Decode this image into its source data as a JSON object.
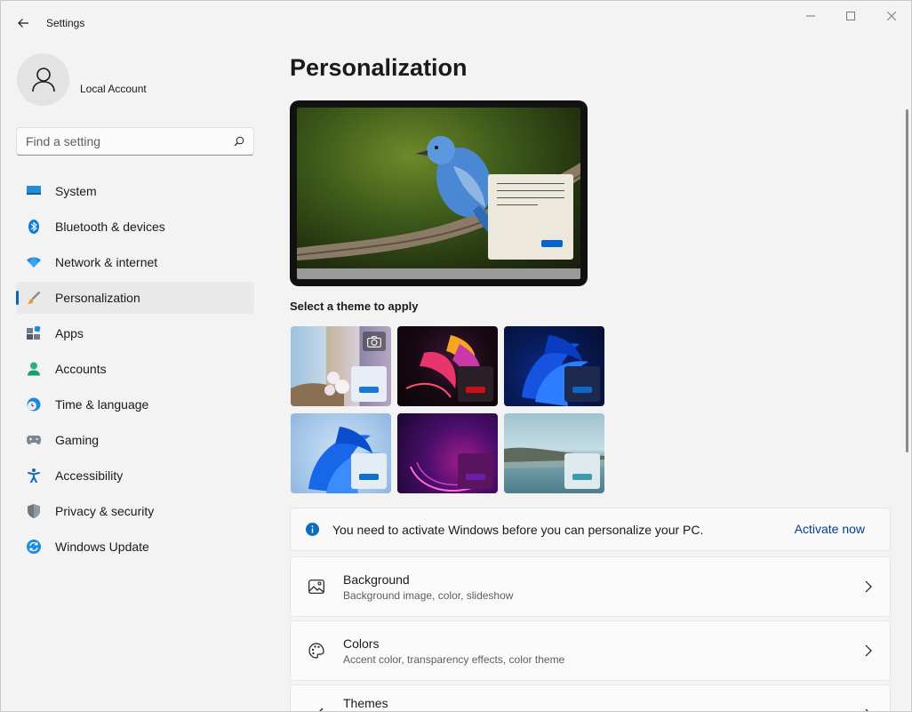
{
  "window": {
    "title": "Settings",
    "controls": {
      "minimize_icon": "minimize-icon",
      "maximize_icon": "maximize-icon",
      "close_icon": "close-icon"
    }
  },
  "account": {
    "name": "Local Account",
    "avatar_icon": "user-icon"
  },
  "search": {
    "placeholder": "Find a setting",
    "value": "",
    "icon": "search-icon"
  },
  "sidebar": {
    "items": [
      {
        "label": "System",
        "icon": "system-icon",
        "active": false
      },
      {
        "label": "Bluetooth & devices",
        "icon": "bluetooth-icon",
        "active": false
      },
      {
        "label": "Network & internet",
        "icon": "wifi-icon",
        "active": false
      },
      {
        "label": "Personalization",
        "icon": "brush-icon",
        "active": true
      },
      {
        "label": "Apps",
        "icon": "apps-icon",
        "active": false
      },
      {
        "label": "Accounts",
        "icon": "accounts-icon",
        "active": false
      },
      {
        "label": "Time & language",
        "icon": "clock-globe-icon",
        "active": false
      },
      {
        "label": "Gaming",
        "icon": "gamepad-icon",
        "active": false
      },
      {
        "label": "Accessibility",
        "icon": "accessibility-icon",
        "active": false
      },
      {
        "label": "Privacy & security",
        "icon": "shield-icon",
        "active": false
      },
      {
        "label": "Windows Update",
        "icon": "update-icon",
        "active": false
      }
    ]
  },
  "main": {
    "title": "Personalization",
    "theme_heading": "Select a theme to apply",
    "themes": [
      {
        "name": "custom-theme",
        "accent": "#1a78d4"
      },
      {
        "name": "glow-theme",
        "accent": "#c8101a"
      },
      {
        "name": "dark-bloom-theme",
        "accent": "#1367c4"
      },
      {
        "name": "light-bloom-theme",
        "accent": "#0f6fc9"
      },
      {
        "name": "flow-theme",
        "accent": "#6b1fa8"
      },
      {
        "name": "lake-theme",
        "accent": "#3f9aac"
      }
    ],
    "notice": {
      "text": "You need to activate Windows before you can personalize your PC.",
      "link": "Activate now",
      "icon": "info-icon"
    },
    "cards": [
      {
        "title": "Background",
        "subtitle": "Background image, color, slideshow",
        "icon": "image-icon"
      },
      {
        "title": "Colors",
        "subtitle": "Accent color, transparency effects, color theme",
        "icon": "palette-icon"
      },
      {
        "title": "Themes",
        "subtitle": "",
        "icon": "brush-icon"
      }
    ]
  },
  "colors": {
    "accent": "#0067c0",
    "link": "#003e92",
    "background": "#f3f3f3"
  }
}
